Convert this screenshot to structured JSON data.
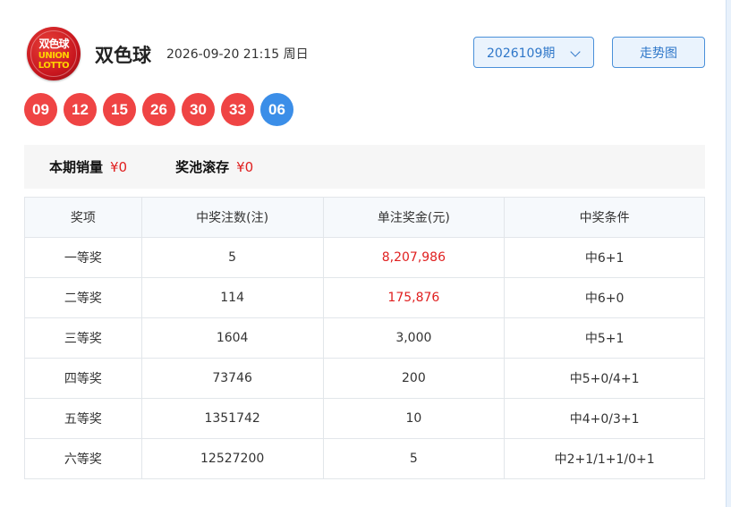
{
  "header": {
    "logo_top": "双色球",
    "logo_mid": "UNION",
    "logo_bottom": "LOTTO",
    "title": "双色球",
    "datetime": "2026-09-20 21:15 周日",
    "issue": "2026109期",
    "trend_button": "走势图"
  },
  "balls": {
    "red": [
      "09",
      "12",
      "15",
      "26",
      "30",
      "33"
    ],
    "blue": "06"
  },
  "colors": {
    "red_ball": "#ef4444",
    "blue_ball": "#3b8ee8",
    "accent": "#2f77c9",
    "highlight": "#e02020"
  },
  "summary": {
    "sales_label": "本期销量",
    "sales_value": "¥0",
    "pool_label": "奖池滚存",
    "pool_value": "¥0"
  },
  "table": {
    "headers": [
      "奖项",
      "中奖注数(注)",
      "单注奖金(元)",
      "中奖条件"
    ],
    "rows": [
      [
        "一等奖",
        "5",
        "8,207,986",
        "中6+1"
      ],
      [
        "二等奖",
        "114",
        "175,876",
        "中6+0"
      ],
      [
        "三等奖",
        "1604",
        "3,000",
        "中5+1"
      ],
      [
        "四等奖",
        "73746",
        "200",
        "中5+0/4+1"
      ],
      [
        "五等奖",
        "1351742",
        "10",
        "中4+0/3+1"
      ],
      [
        "六等奖",
        "12527200",
        "5",
        "中2+1/1+1/0+1"
      ]
    ]
  }
}
